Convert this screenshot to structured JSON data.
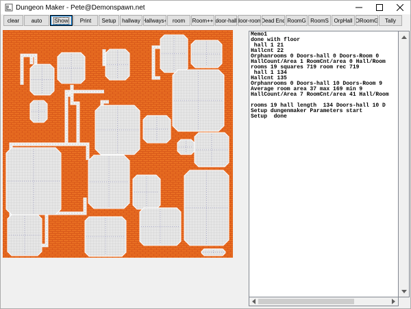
{
  "window": {
    "title": "Dungeon Maker - Pete@Demonspawn.net",
    "minimize_icon": "minimize-icon",
    "maximize_icon": "maximize-icon",
    "close_icon": "close-icon"
  },
  "toolbar": {
    "buttons": [
      {
        "id": "clear",
        "label": "clear"
      },
      {
        "id": "auto",
        "label": "auto"
      },
      {
        "id": "show",
        "label": "Show"
      },
      {
        "id": "print",
        "label": "Print"
      },
      {
        "id": "setup",
        "label": "Setup"
      },
      {
        "id": "hallway",
        "label": "hallway"
      },
      {
        "id": "hallways-plus",
        "label": "Hallways+"
      },
      {
        "id": "room",
        "label": "room"
      },
      {
        "id": "room-plus-plus",
        "label": "Room++"
      },
      {
        "id": "door-hall",
        "label": "door-hall"
      },
      {
        "id": "door-room",
        "label": "door-room"
      },
      {
        "id": "dead-end",
        "label": "Dead End"
      },
      {
        "id": "room-g",
        "label": "RoomG"
      },
      {
        "id": "room-s",
        "label": "RoomS"
      },
      {
        "id": "orp-hall",
        "label": "OrpHall"
      },
      {
        "id": "o-room-g",
        "label": "ORoomG"
      },
      {
        "id": "tally",
        "label": "Tally"
      }
    ]
  },
  "memo": {
    "lines": [
      "Memo1",
      "done with floor",
      " hall 1 21",
      "Hallcnt 22",
      "Orphanrooms 0 Doors-hall 0 Doors-Room 0",
      "HallCount/Area 1 RoomCnt/area 0 Hall/Room",
      "rooms 19 squares 719 room rec 719",
      " hall 1 134",
      "Hallcnt 135",
      "Orphanrooms 0 Doors-hall 10 Doors-Room 9",
      "Average room area 37 max 169 min 9",
      "HallCount/Area 7 RoomCnt/area 41 Hall/Room",
      "",
      "rooms 19 hall length  134 Doors-hall 10 D",
      "Setup dungenmaker Parameters start",
      "Setup  done"
    ]
  },
  "colors": {
    "brick": "#e96f22",
    "mortar": "#d9591a",
    "floor": "#e6e6e6",
    "grid": "#a9a9a9",
    "accent": "#0078d7"
  }
}
